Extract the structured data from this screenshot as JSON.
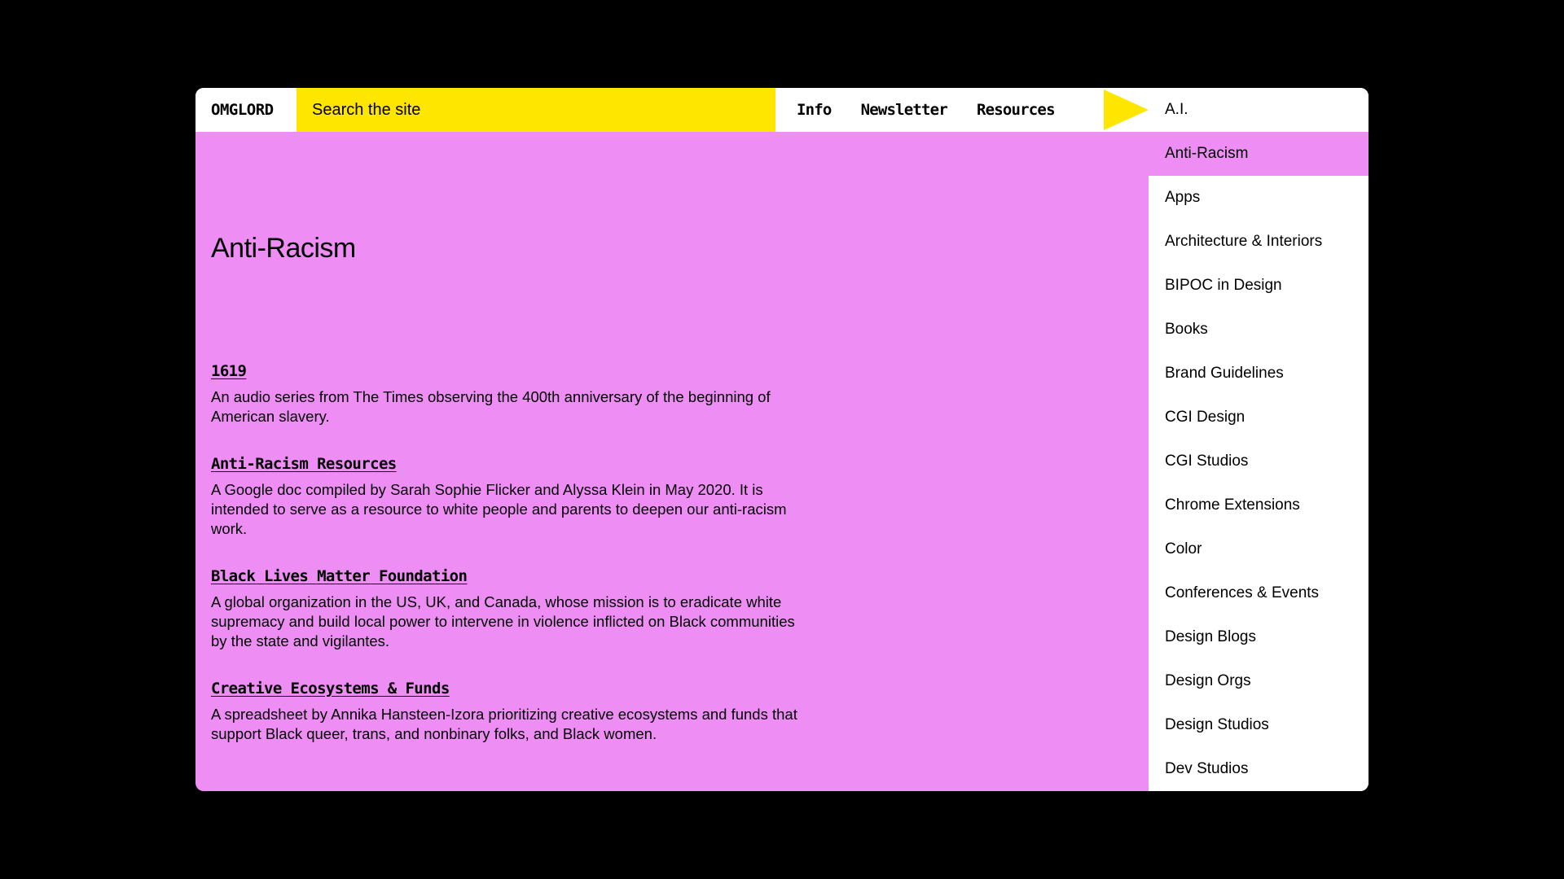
{
  "header": {
    "logo": "OMGLORD",
    "search_placeholder": "Search the site",
    "nav": [
      {
        "label": "Info"
      },
      {
        "label": "Newsletter"
      },
      {
        "label": "Resources"
      }
    ]
  },
  "colors": {
    "page_background": "#000000",
    "accent_pink": "#ee8ef5",
    "accent_yellow": "#ffe600",
    "panel_white": "#ffffff",
    "text": "#000000"
  },
  "icons": {
    "menu_pointer": "arrow-right-icon"
  },
  "categories": {
    "selected": "Anti-Racism",
    "items": [
      {
        "label": "A.I."
      },
      {
        "label": "Anti-Racism"
      },
      {
        "label": "Apps"
      },
      {
        "label": "Architecture & Interiors"
      },
      {
        "label": "BIPOC in Design"
      },
      {
        "label": "Books"
      },
      {
        "label": "Brand Guidelines"
      },
      {
        "label": "CGI Design"
      },
      {
        "label": "CGI Studios"
      },
      {
        "label": "Chrome Extensions"
      },
      {
        "label": "Color"
      },
      {
        "label": "Conferences & Events"
      },
      {
        "label": "Design Blogs"
      },
      {
        "label": "Design Orgs"
      },
      {
        "label": "Design Studios"
      },
      {
        "label": "Dev Studios"
      }
    ]
  },
  "main": {
    "title": "Anti-Racism",
    "resources": [
      {
        "title": "1619",
        "description": "An audio series from The Times observing the 400th anniversary of the beginning of American slavery."
      },
      {
        "title": "Anti-Racism Resources",
        "description": "A Google doc compiled by Sarah Sophie Flicker and Alyssa Klein in May 2020. It is intended to serve as a resource to white people and parents to deepen our anti-racism work."
      },
      {
        "title": "Black Lives Matter Foundation",
        "description": "A global organization in the US, UK, and Canada, whose mission is to eradicate white supremacy and build local power to intervene in violence inflicted on Black communities by the state and vigilantes."
      },
      {
        "title": "Creative Ecosystems & Funds",
        "description": "A spreadsheet by Annika Hansteen-Izora prioritizing creative ecosystems and funds that support Black queer, trans, and nonbinary folks, and Black women."
      }
    ]
  }
}
